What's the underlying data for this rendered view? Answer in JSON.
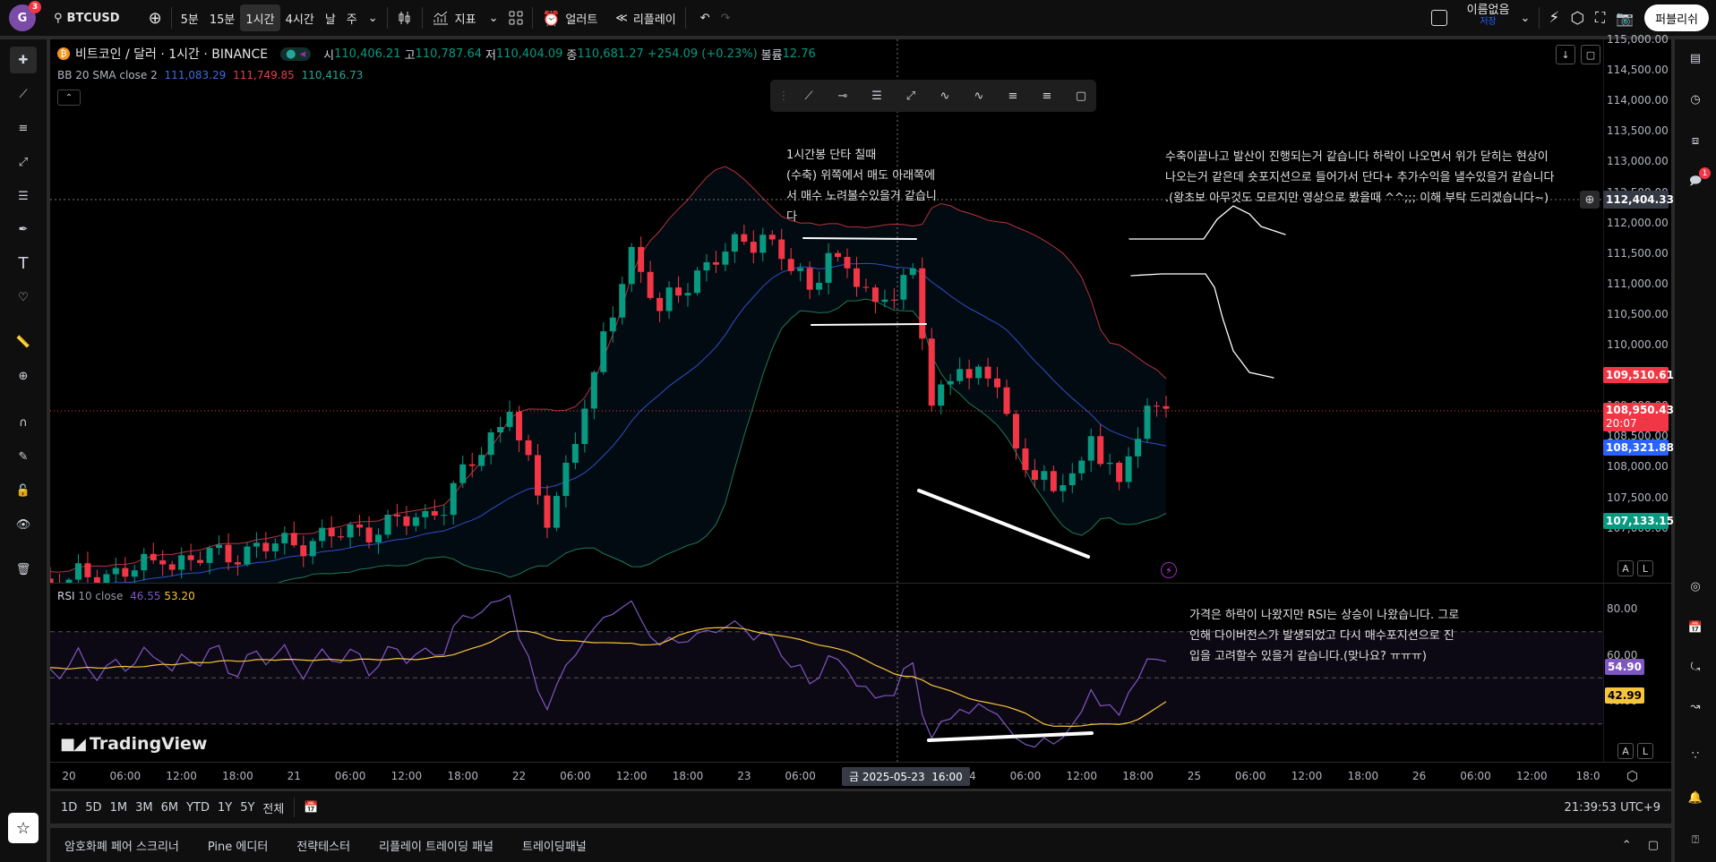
{
  "topbar": {
    "avatar_letter": "G",
    "avatar_badge": "3",
    "symbol": "BTCUSD",
    "intervals": [
      "5분",
      "15분",
      "1시간",
      "4시간",
      "날",
      "주"
    ],
    "active_interval": "1시간",
    "indicators_label": "지표",
    "alert_label": "얼러트",
    "replay_label": "리플레이",
    "layout_name": "이름없음",
    "layout_save": "저장",
    "publish_label": "퍼블리쉬"
  },
  "legend": {
    "title": "비트코인 / 달러 · 1시간 · BINANCE",
    "o_label": "시",
    "o": "110,406.21",
    "h_label": "고",
    "h": "110,787.64",
    "l_label": "저",
    "l": "110,404.09",
    "c_label": "종",
    "c": "110,681.27",
    "change": "+254.09 (+0.23%)",
    "vol_label": "볼륨",
    "vol": "12.76",
    "bb_label": "BB 20 SMA close 2",
    "bb_basis": "111,083.29",
    "bb_upper": "111,749.85",
    "bb_lower": "110,416.73"
  },
  "rsi_legend": {
    "label": "RSI",
    "params": "10 close",
    "value": "46.55",
    "ma": "53.20"
  },
  "notes": {
    "note1": [
      "1시간봉 단타 칠때",
      "(수축) 위쪽에서 매도 아래쪽에",
      "서 매수 노려볼수있을거 같습니",
      "다"
    ],
    "note2": [
      "수축이끝나고 발산이 진행되는거 같습니다 하락이 나오면서 위가 닫히는 현상이",
      "나오는거 같은데 숏포지션으로 들어가서 단다+ 추가수익을 낼수있을거 같습니다",
      ".(왕초보 아무것도 모르지만 영상으로 봤을때 ^^;;; 이해 부탁 드리겠습니다~)"
    ],
    "note3": [
      "가격은 하락이 나왔지만 RSI는 상승이 나왔습니다. 그로",
      "인해 다이버전스가 발생되었고 다시 매수포지션으로 진",
      "입을 고려할수 있을거 같습니다.(맞나요? ㅠㅠㅠ)"
    ]
  },
  "price_axis": [
    "115,000.00",
    "114,500.00",
    "114,000.00",
    "113,500.00",
    "113,000.00",
    "112,500.00",
    "112,000.00",
    "111,500.00",
    "111,000.00",
    "110,500.00",
    "110,000.00",
    "109,500.00",
    "109,000.00",
    "108,500.00",
    "108,000.00",
    "107,500.00",
    "107,000.00"
  ],
  "price_tags": {
    "crosshair": "112,404.33",
    "bb_upper": "109,510.61",
    "last": "108,950.43",
    "countdown": "20:07",
    "bb_basis": "108,321.88",
    "bb_lower": "107,133.15"
  },
  "rsi_axis": [
    "80.00",
    "60.00",
    "40.00"
  ],
  "rsi_tags": {
    "rsi": "54.90",
    "ma": "42.99"
  },
  "time_axis": [
    [
      "20",
      0
    ],
    [
      "06:00",
      6
    ],
    [
      "12:00",
      12
    ],
    [
      "18:00",
      18
    ],
    [
      "21",
      24
    ],
    [
      "06:00",
      30
    ],
    [
      "12:00",
      36
    ],
    [
      "18:00",
      42
    ],
    [
      "22",
      48
    ],
    [
      "06:00",
      54
    ],
    [
      "12:00",
      60
    ],
    [
      "18:00",
      66
    ],
    [
      "23",
      72
    ],
    [
      "06:00",
      78
    ],
    [
      "24",
      96
    ],
    [
      "06:00",
      102
    ],
    [
      "12:00",
      108
    ],
    [
      "18:00",
      114
    ],
    [
      "25",
      120
    ],
    [
      "06:00",
      126
    ],
    [
      "12:00",
      132
    ],
    [
      "18:00",
      138
    ],
    [
      "26",
      144
    ],
    [
      "06:00",
      150
    ],
    [
      "12:00",
      156
    ],
    [
      "18:0",
      162
    ]
  ],
  "crosshair_time": "금 2025-05-23  16:00",
  "range_buttons": [
    "1D",
    "5D",
    "1M",
    "3M",
    "6M",
    "YTD",
    "1Y",
    "5Y",
    "전체"
  ],
  "clock": "21:39:53 UTC+9",
  "bottom_tabs": [
    "암호화폐 페어 스크리너",
    "Pine 에디터",
    "전략테스터",
    "리플레이 트레이딩 패널",
    "트레이딩패널"
  ],
  "logo": "TradingView",
  "scale_buttons": {
    "auto": "A",
    "log": "L"
  },
  "right_badge": "1",
  "colors": {
    "up": "#089981",
    "down": "#f23645",
    "bb_basis": "#2f4fc9",
    "bb_upper": "#b8323c",
    "bb_lower": "#1e7a58",
    "rsi": "#7e57c2",
    "rsi_ma": "#f7c53b",
    "accent": "#2962ff"
  },
  "chart_data": {
    "type": "candlestick",
    "symbol": "BTCUSD",
    "interval": "1h",
    "x_unit": "hours since 2025-05-20 00:00",
    "close_keypoints": [
      [
        -25,
        105800
      ],
      [
        0,
        106150
      ],
      [
        10,
        106400
      ],
      [
        28,
        106860
      ],
      [
        39,
        107200
      ],
      [
        47,
        108900
      ],
      [
        51,
        107000
      ],
      [
        56,
        109550
      ],
      [
        60,
        111600
      ],
      [
        63,
        110550
      ],
      [
        68,
        111350
      ],
      [
        74,
        111800
      ],
      [
        79,
        110900
      ],
      [
        81,
        111500
      ],
      [
        86,
        110700
      ],
      [
        90,
        111250
      ],
      [
        92,
        109000
      ],
      [
        95,
        109600
      ],
      [
        99,
        109300
      ],
      [
        101,
        108300
      ],
      [
        105,
        107600
      ],
      [
        108,
        108100
      ],
      [
        109,
        108500
      ],
      [
        112,
        107750
      ],
      [
        115,
        109000
      ],
      [
        117,
        108950
      ]
    ],
    "ylim": [
      106000,
      115200
    ],
    "rsi_ylim": [
      20,
      90
    ],
    "bb": {
      "length": 20,
      "mult": 2
    },
    "rsi": {
      "length": 10,
      "ma_length": 14
    }
  }
}
